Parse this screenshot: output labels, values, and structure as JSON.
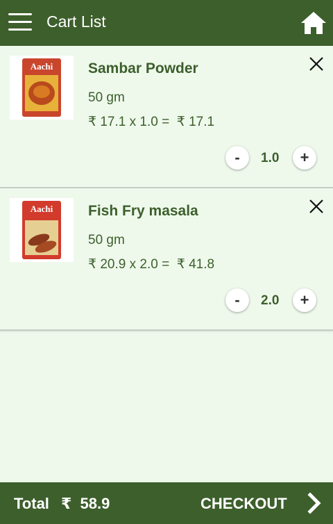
{
  "header": {
    "title": "Cart List",
    "menu_icon": "hamburger-menu-icon",
    "home_icon": "home-icon"
  },
  "items": [
    {
      "name": "Sambar Powder",
      "weight": "50 gm",
      "calc": "₹ 17.1 x 1.0 =  ₹ 17.1",
      "qty": "1.0",
      "image_brand": "Aachi",
      "minus_label": "-",
      "plus_label": "+"
    },
    {
      "name": "Fish Fry masala",
      "weight": "50 gm",
      "calc": "₹ 20.9 x 2.0 =  ₹ 41.8",
      "qty": "2.0",
      "image_brand": "Aachi",
      "minus_label": "-",
      "plus_label": "+"
    }
  ],
  "footer": {
    "total_label": "Total",
    "total_value": "₹  58.9",
    "checkout_label": "CHECKOUT",
    "chevron_icon": "chevron-right-icon"
  },
  "colors": {
    "primary": "#3d5f2c",
    "background": "#eef9ec"
  }
}
